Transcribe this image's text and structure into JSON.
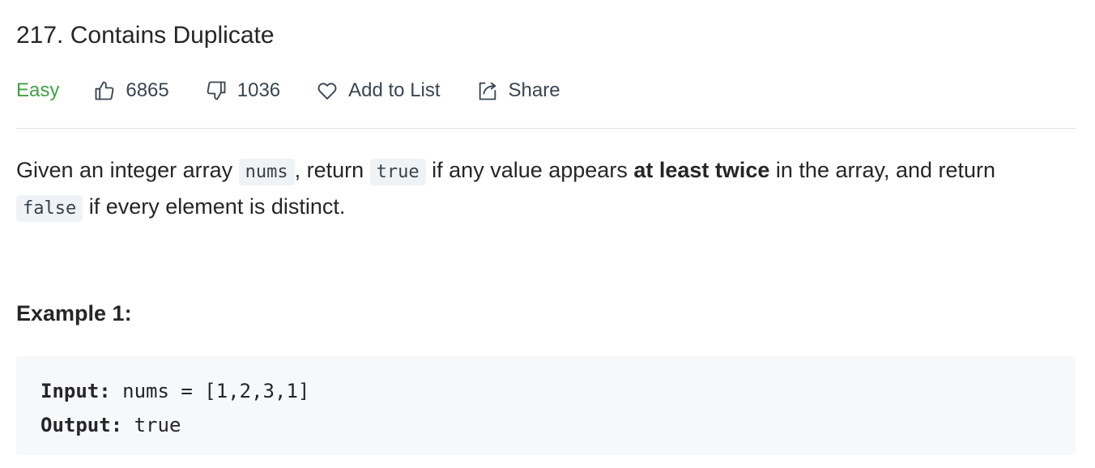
{
  "problem": {
    "title": "217. Contains Duplicate",
    "difficulty": "Easy",
    "likes": "6865",
    "dislikes": "1036",
    "add_to_list_label": "Add to List",
    "share_label": "Share"
  },
  "description": {
    "p1": "Given an integer array ",
    "code_nums": "nums",
    "p2": ", return ",
    "code_true": "true",
    "p3": " if any value appears ",
    "bold": "at least twice",
    "p4": " in the array, and return ",
    "code_false": "false",
    "p5": " if every element is distinct."
  },
  "example": {
    "title": "Example 1:",
    "input_label": "Input:",
    "input_value": " nums = [1,2,3,1]",
    "output_label": "Output:",
    "output_value": " true"
  },
  "colors": {
    "easy": "#43a047",
    "code_bg": "#f0f3f5",
    "example_bg": "#f6f8fa"
  },
  "icons": [
    "thumbs-up-icon",
    "thumbs-down-icon",
    "heart-icon",
    "share-icon"
  ]
}
